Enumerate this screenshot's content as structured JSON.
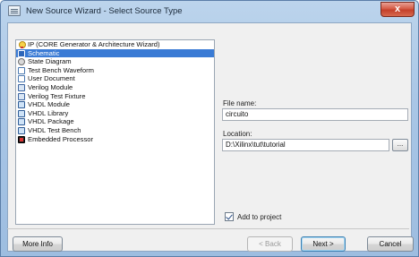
{
  "window": {
    "title": "New Source Wizard - Select Source Type",
    "close_glyph": "x"
  },
  "source_types": [
    {
      "label": "IP (CORE Generator & Architecture Wizard)",
      "icon": "bulb-icon",
      "selected": false
    },
    {
      "label": "Schematic",
      "icon": "schematic-icon",
      "selected": true
    },
    {
      "label": "State Diagram",
      "icon": "state-diagram-icon",
      "selected": false
    },
    {
      "label": "Test Bench Waveform",
      "icon": "waveform-icon",
      "selected": false
    },
    {
      "label": "User Document",
      "icon": "document-icon",
      "selected": false
    },
    {
      "label": "Verilog Module",
      "icon": "verilog-icon",
      "selected": false
    },
    {
      "label": "Verilog Test Fixture",
      "icon": "verilog-icon",
      "selected": false
    },
    {
      "label": "VHDL Module",
      "icon": "vhdl-icon",
      "selected": false
    },
    {
      "label": "VHDL Library",
      "icon": "vhdl-icon",
      "selected": false
    },
    {
      "label": "VHDL Package",
      "icon": "vhdl-icon",
      "selected": false
    },
    {
      "label": "VHDL Test Bench",
      "icon": "vhdl-icon",
      "selected": false
    },
    {
      "label": "Embedded Processor",
      "icon": "processor-icon",
      "selected": false
    }
  ],
  "form": {
    "file_name_label": "File name:",
    "file_name_value": "circuito",
    "location_label": "Location:",
    "location_value": "D:\\Xilinx\\tut\\tutorial",
    "browse_label": "...",
    "add_to_project_label": "Add to project",
    "add_to_project_checked": true
  },
  "buttons": {
    "more_info": "More Info",
    "back": "< Back",
    "next": "Next >",
    "cancel": "Cancel"
  },
  "colors": {
    "selection": "#3a7bd5",
    "close_button": "#c4402a"
  }
}
